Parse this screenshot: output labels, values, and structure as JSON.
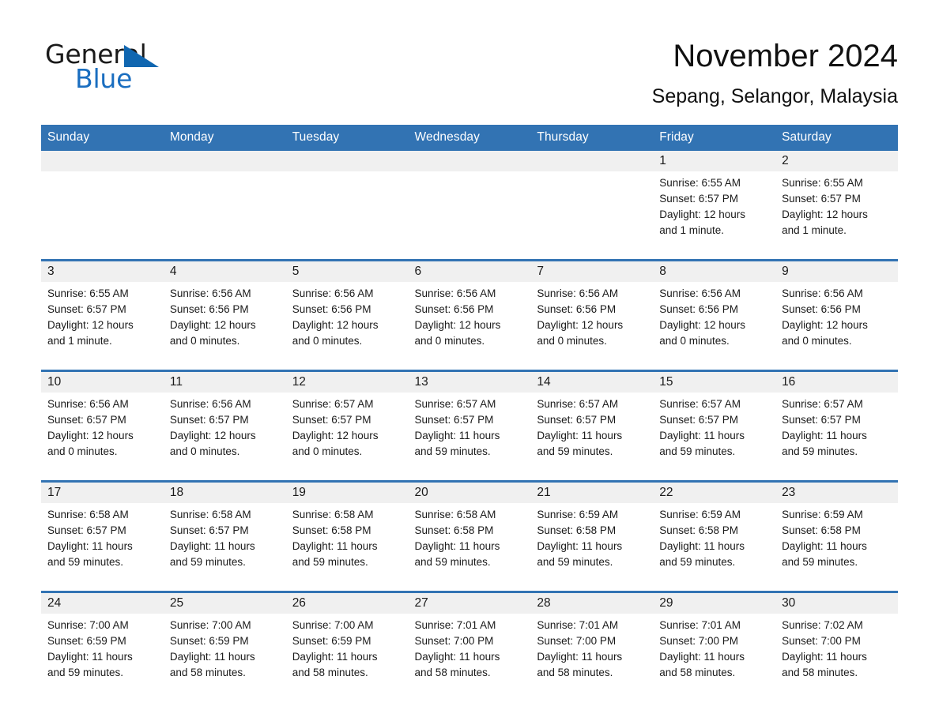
{
  "brand": {
    "name_part1": "General",
    "name_part2": "Blue",
    "mark": "triangle-logo",
    "accent_color": "#1a6ec0"
  },
  "header": {
    "title": "November 2024",
    "subtitle": "Sepang, Selangor, Malaysia"
  },
  "theme": {
    "header_blue": "#3273b3",
    "daynum_band": "#f0f0f0",
    "text": "#1a1a1a"
  },
  "weekday_headers": [
    "Sunday",
    "Monday",
    "Tuesday",
    "Wednesday",
    "Thursday",
    "Friday",
    "Saturday"
  ],
  "labels": {
    "sunrise_prefix": "Sunrise:",
    "sunset_prefix": "Sunset:",
    "daylight_prefix": "Daylight:"
  },
  "weeks": [
    {
      "days": [
        {
          "num": "",
          "l1": "",
          "l2": "",
          "l3": "",
          "l4": ""
        },
        {
          "num": "",
          "l1": "",
          "l2": "",
          "l3": "",
          "l4": ""
        },
        {
          "num": "",
          "l1": "",
          "l2": "",
          "l3": "",
          "l4": ""
        },
        {
          "num": "",
          "l1": "",
          "l2": "",
          "l3": "",
          "l4": ""
        },
        {
          "num": "",
          "l1": "",
          "l2": "",
          "l3": "",
          "l4": ""
        },
        {
          "num": "1",
          "l1": "Sunrise: 6:55 AM",
          "l2": "Sunset: 6:57 PM",
          "l3": "Daylight: 12 hours",
          "l4": "and 1 minute."
        },
        {
          "num": "2",
          "l1": "Sunrise: 6:55 AM",
          "l2": "Sunset: 6:57 PM",
          "l3": "Daylight: 12 hours",
          "l4": "and 1 minute."
        }
      ]
    },
    {
      "days": [
        {
          "num": "3",
          "l1": "Sunrise: 6:55 AM",
          "l2": "Sunset: 6:57 PM",
          "l3": "Daylight: 12 hours",
          "l4": "and 1 minute."
        },
        {
          "num": "4",
          "l1": "Sunrise: 6:56 AM",
          "l2": "Sunset: 6:56 PM",
          "l3": "Daylight: 12 hours",
          "l4": "and 0 minutes."
        },
        {
          "num": "5",
          "l1": "Sunrise: 6:56 AM",
          "l2": "Sunset: 6:56 PM",
          "l3": "Daylight: 12 hours",
          "l4": "and 0 minutes."
        },
        {
          "num": "6",
          "l1": "Sunrise: 6:56 AM",
          "l2": "Sunset: 6:56 PM",
          "l3": "Daylight: 12 hours",
          "l4": "and 0 minutes."
        },
        {
          "num": "7",
          "l1": "Sunrise: 6:56 AM",
          "l2": "Sunset: 6:56 PM",
          "l3": "Daylight: 12 hours",
          "l4": "and 0 minutes."
        },
        {
          "num": "8",
          "l1": "Sunrise: 6:56 AM",
          "l2": "Sunset: 6:56 PM",
          "l3": "Daylight: 12 hours",
          "l4": "and 0 minutes."
        },
        {
          "num": "9",
          "l1": "Sunrise: 6:56 AM",
          "l2": "Sunset: 6:56 PM",
          "l3": "Daylight: 12 hours",
          "l4": "and 0 minutes."
        }
      ]
    },
    {
      "days": [
        {
          "num": "10",
          "l1": "Sunrise: 6:56 AM",
          "l2": "Sunset: 6:57 PM",
          "l3": "Daylight: 12 hours",
          "l4": "and 0 minutes."
        },
        {
          "num": "11",
          "l1": "Sunrise: 6:56 AM",
          "l2": "Sunset: 6:57 PM",
          "l3": "Daylight: 12 hours",
          "l4": "and 0 minutes."
        },
        {
          "num": "12",
          "l1": "Sunrise: 6:57 AM",
          "l2": "Sunset: 6:57 PM",
          "l3": "Daylight: 12 hours",
          "l4": "and 0 minutes."
        },
        {
          "num": "13",
          "l1": "Sunrise: 6:57 AM",
          "l2": "Sunset: 6:57 PM",
          "l3": "Daylight: 11 hours",
          "l4": "and 59 minutes."
        },
        {
          "num": "14",
          "l1": "Sunrise: 6:57 AM",
          "l2": "Sunset: 6:57 PM",
          "l3": "Daylight: 11 hours",
          "l4": "and 59 minutes."
        },
        {
          "num": "15",
          "l1": "Sunrise: 6:57 AM",
          "l2": "Sunset: 6:57 PM",
          "l3": "Daylight: 11 hours",
          "l4": "and 59 minutes."
        },
        {
          "num": "16",
          "l1": "Sunrise: 6:57 AM",
          "l2": "Sunset: 6:57 PM",
          "l3": "Daylight: 11 hours",
          "l4": "and 59 minutes."
        }
      ]
    },
    {
      "days": [
        {
          "num": "17",
          "l1": "Sunrise: 6:58 AM",
          "l2": "Sunset: 6:57 PM",
          "l3": "Daylight: 11 hours",
          "l4": "and 59 minutes."
        },
        {
          "num": "18",
          "l1": "Sunrise: 6:58 AM",
          "l2": "Sunset: 6:57 PM",
          "l3": "Daylight: 11 hours",
          "l4": "and 59 minutes."
        },
        {
          "num": "19",
          "l1": "Sunrise: 6:58 AM",
          "l2": "Sunset: 6:58 PM",
          "l3": "Daylight: 11 hours",
          "l4": "and 59 minutes."
        },
        {
          "num": "20",
          "l1": "Sunrise: 6:58 AM",
          "l2": "Sunset: 6:58 PM",
          "l3": "Daylight: 11 hours",
          "l4": "and 59 minutes."
        },
        {
          "num": "21",
          "l1": "Sunrise: 6:59 AM",
          "l2": "Sunset: 6:58 PM",
          "l3": "Daylight: 11 hours",
          "l4": "and 59 minutes."
        },
        {
          "num": "22",
          "l1": "Sunrise: 6:59 AM",
          "l2": "Sunset: 6:58 PM",
          "l3": "Daylight: 11 hours",
          "l4": "and 59 minutes."
        },
        {
          "num": "23",
          "l1": "Sunrise: 6:59 AM",
          "l2": "Sunset: 6:58 PM",
          "l3": "Daylight: 11 hours",
          "l4": "and 59 minutes."
        }
      ]
    },
    {
      "days": [
        {
          "num": "24",
          "l1": "Sunrise: 7:00 AM",
          "l2": "Sunset: 6:59 PM",
          "l3": "Daylight: 11 hours",
          "l4": "and 59 minutes."
        },
        {
          "num": "25",
          "l1": "Sunrise: 7:00 AM",
          "l2": "Sunset: 6:59 PM",
          "l3": "Daylight: 11 hours",
          "l4": "and 58 minutes."
        },
        {
          "num": "26",
          "l1": "Sunrise: 7:00 AM",
          "l2": "Sunset: 6:59 PM",
          "l3": "Daylight: 11 hours",
          "l4": "and 58 minutes."
        },
        {
          "num": "27",
          "l1": "Sunrise: 7:01 AM",
          "l2": "Sunset: 7:00 PM",
          "l3": "Daylight: 11 hours",
          "l4": "and 58 minutes."
        },
        {
          "num": "28",
          "l1": "Sunrise: 7:01 AM",
          "l2": "Sunset: 7:00 PM",
          "l3": "Daylight: 11 hours",
          "l4": "and 58 minutes."
        },
        {
          "num": "29",
          "l1": "Sunrise: 7:01 AM",
          "l2": "Sunset: 7:00 PM",
          "l3": "Daylight: 11 hours",
          "l4": "and 58 minutes."
        },
        {
          "num": "30",
          "l1": "Sunrise: 7:02 AM",
          "l2": "Sunset: 7:00 PM",
          "l3": "Daylight: 11 hours",
          "l4": "and 58 minutes."
        }
      ]
    }
  ]
}
